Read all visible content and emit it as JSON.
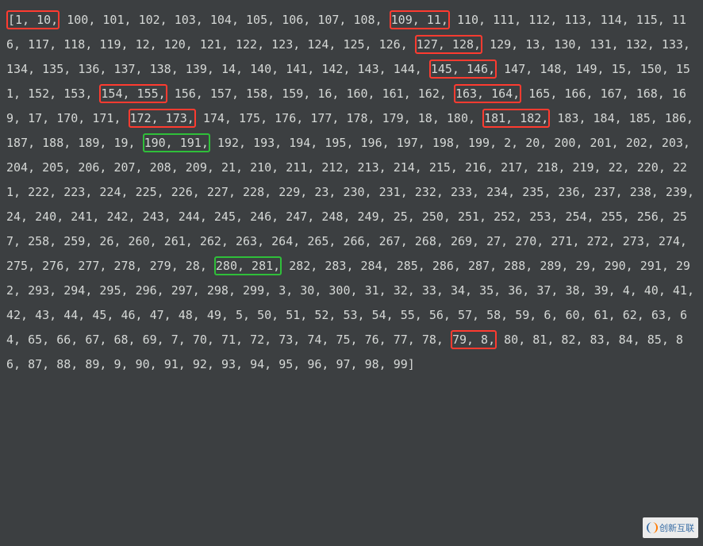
{
  "code_block": {
    "open_bracket": "[",
    "highlights": [
      {
        "index_start": 0,
        "length": 2,
        "class": "hl-red"
      },
      {
        "index_start": 11,
        "length": 2,
        "class": "hl-red"
      },
      {
        "index_start": 31,
        "length": 2,
        "class": "hl-red"
      },
      {
        "index_start": 51,
        "length": 2,
        "class": "hl-red"
      },
      {
        "index_start": 61,
        "length": 2,
        "class": "hl-red"
      },
      {
        "index_start": 71,
        "length": 2,
        "class": "hl-red"
      },
      {
        "index_start": 81,
        "length": 2,
        "class": "hl-red"
      },
      {
        "index_start": 91,
        "length": 2,
        "class": "hl-red"
      },
      {
        "index_start": 101,
        "length": 2,
        "class": "hl-green"
      },
      {
        "index_start": 201,
        "length": 2,
        "class": "hl-green"
      },
      {
        "index_start": 277,
        "length": 2,
        "class": "hl-red"
      }
    ],
    "values": [
      "1",
      "10",
      "100",
      "101",
      "102",
      "103",
      "104",
      "105",
      "106",
      "107",
      "108",
      "109",
      "11",
      "110",
      "111",
      "112",
      "113",
      "114",
      "115",
      "116",
      "117",
      "118",
      "119",
      "12",
      "120",
      "121",
      "122",
      "123",
      "124",
      "125",
      "126",
      "127",
      "128",
      "129",
      "13",
      "130",
      "131",
      "132",
      "133",
      "134",
      "135",
      "136",
      "137",
      "138",
      "139",
      "14",
      "140",
      "141",
      "142",
      "143",
      "144",
      "145",
      "146",
      "147",
      "148",
      "149",
      "15",
      "150",
      "151",
      "152",
      "153",
      "154",
      "155",
      "156",
      "157",
      "158",
      "159",
      "16",
      "160",
      "161",
      "162",
      "163",
      "164",
      "165",
      "166",
      "167",
      "168",
      "169",
      "17",
      "170",
      "171",
      "172",
      "173",
      "174",
      "175",
      "176",
      "177",
      "178",
      "179",
      "18",
      "180",
      "181",
      "182",
      "183",
      "184",
      "185",
      "186",
      "187",
      "188",
      "189",
      "19",
      "190",
      "191",
      "192",
      "193",
      "194",
      "195",
      "196",
      "197",
      "198",
      "199",
      "2",
      "20",
      "200",
      "201",
      "202",
      "203",
      "204",
      "205",
      "206",
      "207",
      "208",
      "209",
      "21",
      "210",
      "211",
      "212",
      "213",
      "214",
      "215",
      "216",
      "217",
      "218",
      "219",
      "22",
      "220",
      "221",
      "222",
      "223",
      "224",
      "225",
      "226",
      "227",
      "228",
      "229",
      "23",
      "230",
      "231",
      "232",
      "233",
      "234",
      "235",
      "236",
      "237",
      "238",
      "239",
      "24",
      "240",
      "241",
      "242",
      "243",
      "244",
      "245",
      "246",
      "247",
      "248",
      "249",
      "25",
      "250",
      "251",
      "252",
      "253",
      "254",
      "255",
      "256",
      "257",
      "258",
      "259",
      "26",
      "260",
      "261",
      "262",
      "263",
      "264",
      "265",
      "266",
      "267",
      "268",
      "269",
      "27",
      "270",
      "271",
      "272",
      "273",
      "274",
      "275",
      "276",
      "277",
      "278",
      "279",
      "28",
      "280",
      "281",
      "282",
      "283",
      "284",
      "285",
      "286",
      "287",
      "288",
      "289",
      "29",
      "290",
      "291",
      "292",
      "293",
      "294",
      "295",
      "296",
      "297",
      "298",
      "299",
      "3",
      "30",
      "300",
      "31",
      "32",
      "33",
      "34",
      "35",
      "36",
      "37",
      "38",
      "39",
      "4",
      "40",
      "41",
      "42",
      "43",
      "44",
      "45",
      "46",
      "47",
      "48",
      "49",
      "5",
      "50",
      "51",
      "52",
      "53",
      "54",
      "55",
      "56",
      "57",
      "58",
      "59",
      "6",
      "60",
      "61",
      "62",
      "63",
      "64",
      "65",
      "66",
      "67",
      "68",
      "69",
      "7",
      "70",
      "71",
      "72",
      "73",
      "74",
      "75",
      "76",
      "77",
      "78",
      "79",
      "8",
      "80",
      "81",
      "82",
      "83",
      "84",
      "85",
      "86",
      "87",
      "88",
      "89",
      "9",
      "90",
      "91",
      "92",
      "93",
      "94",
      "95",
      "96",
      "97",
      "98",
      "99"
    ],
    "close_bracket": "]"
  },
  "watermark": {
    "text": "创新互联"
  }
}
